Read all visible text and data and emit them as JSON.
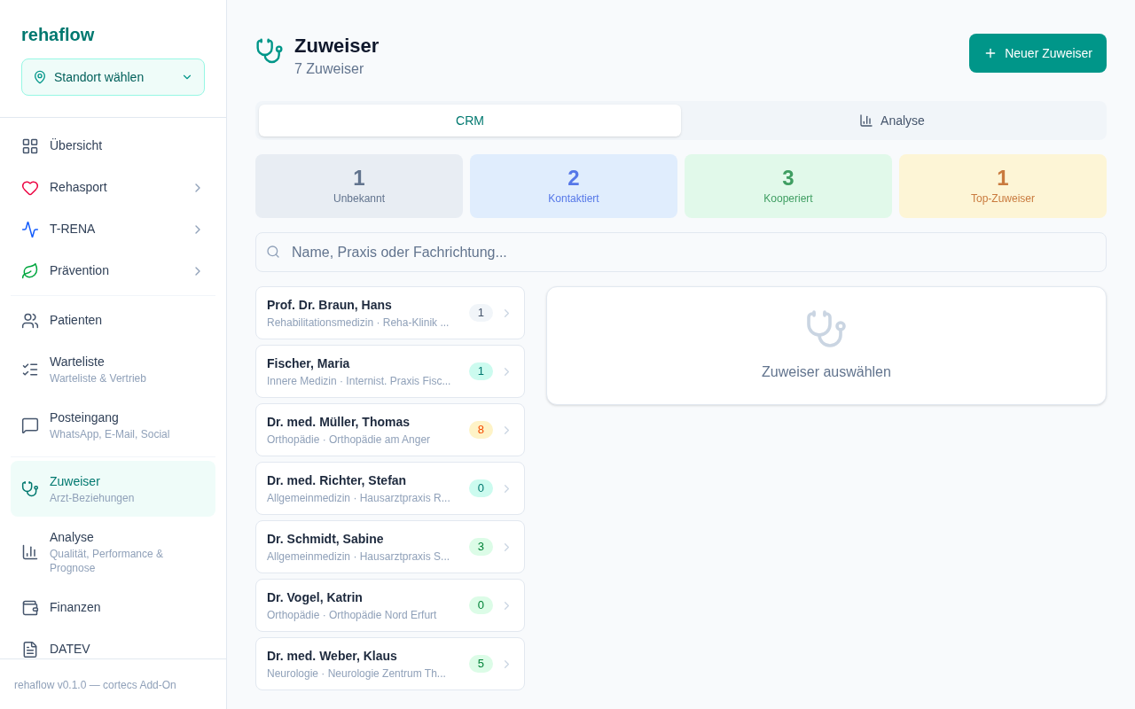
{
  "sidebar": {
    "brand": "rehaflow",
    "location_select": "Standort wählen",
    "groups": [
      [
        {
          "label": "Übersicht",
          "expandable": false,
          "selected": false
        },
        {
          "label": "Rehasport",
          "expandable": true,
          "selected": false
        },
        {
          "label": "T-RENA",
          "expandable": true,
          "selected": false
        },
        {
          "label": "Prävention",
          "expandable": true,
          "selected": false
        }
      ],
      [
        {
          "label": "Patienten",
          "expandable": false,
          "selected": false
        },
        {
          "label": "Warteliste",
          "sublabel": "Warteliste & Vertrieb",
          "expandable": false,
          "selected": false
        },
        {
          "label": "Posteingang",
          "sublabel": "WhatsApp, E-Mail, Social",
          "expandable": false,
          "selected": false
        }
      ],
      [
        {
          "label": "Zuweiser",
          "sublabel": "Arzt-Beziehungen",
          "expandable": false,
          "selected": true
        },
        {
          "label": "Analyse",
          "sublabel": "Qualität, Performance & Prognose",
          "expandable": false,
          "selected": false
        },
        {
          "label": "Finanzen",
          "expandable": false,
          "selected": false
        },
        {
          "label": "DATEV",
          "expandable": false,
          "selected": false
        }
      ]
    ],
    "footer": "rehaflow v0.1.0 — cortecs Add-On"
  },
  "header": {
    "title": "Zuweiser",
    "subtitle": "7 Zuweiser",
    "new_button": "Neuer Zuweiser"
  },
  "tabs": [
    {
      "label": "CRM",
      "selected": true
    },
    {
      "label": "Analyse",
      "selected": false
    }
  ],
  "stats": [
    {
      "value": "1",
      "label": "Unbekannt",
      "color": "#e8edf3"
    },
    {
      "value": "2",
      "label": "Kontaktiert",
      "color": "#e0edfd"
    },
    {
      "value": "3",
      "label": "Kooperiert",
      "color": "#e1f9ea"
    },
    {
      "value": "1",
      "label": "Top-Zuweiser",
      "color": "#fdf5d6"
    }
  ],
  "search": {
    "placeholder": "Name, Praxis oder Fachrichtung..."
  },
  "referrers": [
    {
      "name": "Prof. Dr. Braun, Hans",
      "detail": "Rehabilitationsmedizin · Reha-Klinik ...",
      "count": "1",
      "color": "#f1f5f9"
    },
    {
      "name": "Fischer, Maria",
      "detail": "Innere Medizin · Internist. Praxis Fisc...",
      "count": "1",
      "color": "#ccfbef"
    },
    {
      "name": "Dr. med. Müller, Thomas",
      "detail": "Orthopädie · Orthopädie am Anger",
      "count": "8",
      "color": "#fef3c7"
    },
    {
      "name": "Dr. med. Richter, Stefan",
      "detail": "Allgemeinmedizin · Hausarztpraxis R...",
      "count": "0",
      "color": "#ccfbef"
    },
    {
      "name": "Dr. Schmidt, Sabine",
      "detail": "Allgemeinmedizin · Hausarztpraxis S...",
      "count": "3",
      "color": "#dcfce7"
    },
    {
      "name": "Dr. Vogel, Katrin",
      "detail": "Orthopädie · Orthopädie Nord Erfurt",
      "count": "0",
      "color": "#dcfce7"
    },
    {
      "name": "Dr. med. Weber, Klaus",
      "detail": "Neurologie · Neurologie Zentrum Th...",
      "count": "5",
      "color": "#dcfce7"
    }
  ],
  "detail_panel": {
    "empty_text": "Zuweiser auswählen"
  }
}
